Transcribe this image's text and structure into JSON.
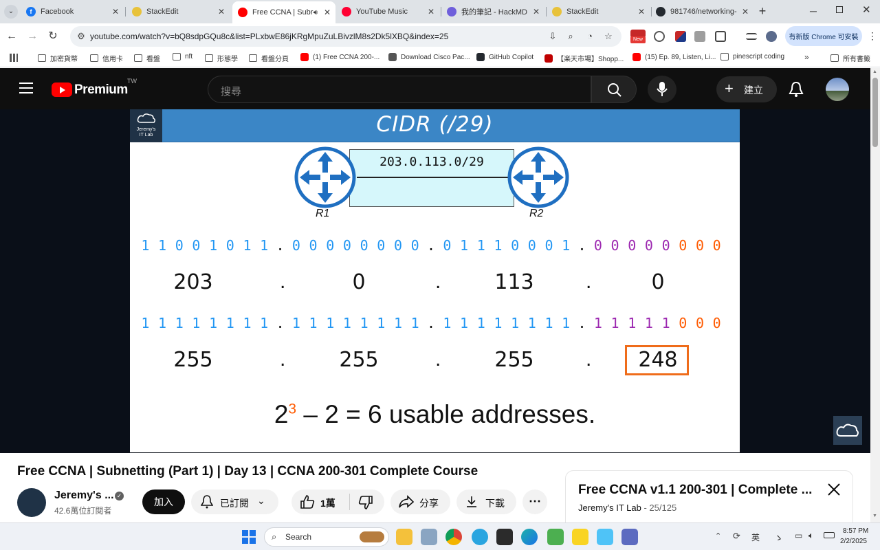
{
  "tabs": [
    {
      "title": "Facebook",
      "color": "#1877f2",
      "glyph": "f"
    },
    {
      "title": "StackEdit",
      "color": "#e8c23a",
      "glyph": ""
    },
    {
      "title": "Free CCNA | Subr",
      "color": "#ff0000",
      "glyph": "",
      "active": true
    },
    {
      "title": "YouTube Music",
      "color": "#ff0033",
      "glyph": ""
    },
    {
      "title": "我的筆記 - HackMD",
      "color": "#6f5fdb",
      "glyph": ""
    },
    {
      "title": "StackEdit",
      "color": "#e8c23a",
      "glyph": ""
    },
    {
      "title": "981746/networking-",
      "color": "#24292f",
      "glyph": ""
    }
  ],
  "toolbar": {
    "url": "youtube.com/watch?v=bQ8sdpGQu8c&list=PLxbwE86jKRgMpuZuLBivzlM8s2Dk5lXBQ&index=25",
    "update_label": "有新版 Chrome 可安裝",
    "new_badge": "New"
  },
  "bookmarks": [
    {
      "label": "加密貨幣",
      "kind": "folder"
    },
    {
      "label": "信用卡",
      "kind": "folder"
    },
    {
      "label": "看盤",
      "kind": "folder"
    },
    {
      "label": "nft",
      "kind": "folder"
    },
    {
      "label": "形態學",
      "kind": "folder"
    },
    {
      "label": "看盤分頁",
      "kind": "folder"
    },
    {
      "label": "(1) Free CCNA 200-...",
      "kind": "yt"
    },
    {
      "label": "Download Cisco Pac...",
      "kind": "cisco"
    },
    {
      "label": "GitHub Copilot",
      "kind": "gh"
    },
    {
      "label": "【楽天市場】Shopp...",
      "kind": "r"
    },
    {
      "label": "(15) Ep. 89, Listen, Li...",
      "kind": "yt"
    },
    {
      "label": "pinescript coding",
      "kind": "folder"
    }
  ],
  "bookmarks_all": "所有書籤",
  "yt": {
    "logo_text": "Premium",
    "region": "TW",
    "search_placeholder": "搜尋",
    "create_label": "建立"
  },
  "slide": {
    "title": "CIDR (/29)",
    "logo_line1": "Jeremy's",
    "logo_line2": "IT Lab",
    "network": "203.0.113.0/29",
    "r1": "R1",
    "r2": "R2",
    "ip_bits": [
      [
        "1",
        "1",
        "0",
        "0",
        "1",
        "0",
        "1",
        "1"
      ],
      [
        "0",
        "0",
        "0",
        "0",
        "0",
        "0",
        "0",
        "0"
      ],
      [
        "0",
        "1",
        "1",
        "1",
        "0",
        "0",
        "0",
        "1"
      ],
      [
        "0",
        "0",
        "0",
        "0",
        "0",
        "0",
        "0",
        "0"
      ]
    ],
    "ip_decimal": [
      "203",
      "0",
      "113",
      "0"
    ],
    "mask_bits": [
      [
        "1",
        "1",
        "1",
        "1",
        "1",
        "1",
        "1",
        "1"
      ],
      [
        "1",
        "1",
        "1",
        "1",
        "1",
        "1",
        "1",
        "1"
      ],
      [
        "1",
        "1",
        "1",
        "1",
        "1",
        "1",
        "1",
        "1"
      ],
      [
        "1",
        "1",
        "1",
        "1",
        "1",
        "0",
        "0",
        "0"
      ]
    ],
    "mask_decimal": [
      "255",
      "255",
      "255",
      "248"
    ],
    "dot": ".",
    "formula_base": "2",
    "formula_exp": "3",
    "formula_rest": " – 2 = 6 usable addresses.",
    "colors": {
      "blue": "#2196f3",
      "purple": "#9c27b0",
      "orange": "#ff5a00",
      "header": "#3b86c6"
    }
  },
  "video": {
    "title": "Free CCNA | Subnetting (Part 1) | Day 13 | CCNA 200-301 Complete Course",
    "channel": "Jeremy's ...",
    "subscribers": "42.6萬位訂閱者",
    "join_label": "加入",
    "subscribed_label": "已訂閱",
    "likes": "1萬",
    "share_label": "分享",
    "download_label": "下載"
  },
  "playlist": {
    "title": "Free CCNA v1.1 200-301 | Complete ...",
    "channel": "Jeremy's IT Lab",
    "position": "25/125"
  },
  "taskbar": {
    "search_label": "Search",
    "ime": "英",
    "time": "8:57 PM",
    "date": "2/2/2025"
  }
}
